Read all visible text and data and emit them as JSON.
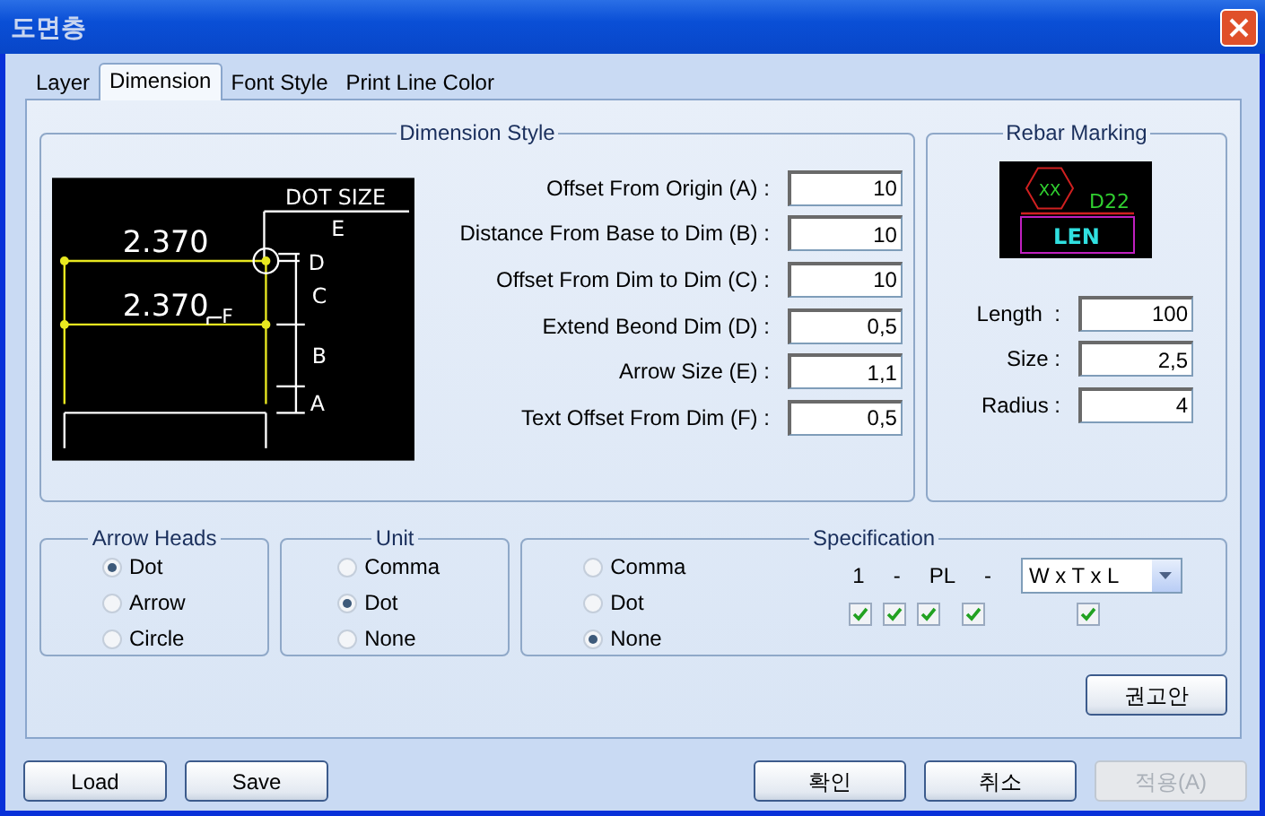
{
  "window": {
    "title": "도면층"
  },
  "tabs": [
    {
      "label": "Layer",
      "selected": false
    },
    {
      "label": "Dimension",
      "selected": true
    },
    {
      "label": "Font Style",
      "selected": false
    },
    {
      "label": "Print Line Color",
      "selected": false
    }
  ],
  "dimension_style": {
    "title": "Dimension Style",
    "diagram_labels": [
      "DOT SIZE",
      "E",
      "2.370",
      "D",
      "C",
      "2.370",
      "F",
      "B",
      "A"
    ],
    "fields": [
      {
        "label": "Offset From Origin (A) :",
        "value": "10"
      },
      {
        "label": "Distance From Base to Dim (B) :",
        "value": "10"
      },
      {
        "label": "Offset From Dim to Dim (C) :",
        "value": "10"
      },
      {
        "label": "Extend Beond Dim (D) :",
        "value": "0,5"
      },
      {
        "label": "Arrow Size (E) :",
        "value": "1,1"
      },
      {
        "label": "Text Offset From Dim (F) :",
        "value": "0,5"
      }
    ]
  },
  "rebar_marking": {
    "title": "Rebar Marking",
    "preview_labels": [
      "XX",
      "D22",
      "LEN"
    ],
    "fields": [
      {
        "label": "Length  :",
        "value": "100"
      },
      {
        "label": "Size :",
        "value": "2,5"
      },
      {
        "label": "Radius :",
        "value": "4"
      }
    ]
  },
  "arrow_heads": {
    "title": "Arrow Heads",
    "options": [
      {
        "label": "Dot",
        "selected": true
      },
      {
        "label": "Arrow",
        "selected": false
      },
      {
        "label": "Circle",
        "selected": false
      }
    ]
  },
  "unit": {
    "title": "Unit",
    "options": [
      {
        "label": "Comma",
        "selected": false
      },
      {
        "label": "Dot",
        "selected": true
      },
      {
        "label": "None",
        "selected": false
      }
    ]
  },
  "specification": {
    "title": "Specification",
    "options": [
      {
        "label": "Comma",
        "selected": false
      },
      {
        "label": "Dot",
        "selected": false
      },
      {
        "label": "None",
        "selected": true
      }
    ],
    "pattern": [
      "1",
      "-",
      "PL",
      "-"
    ],
    "format": "W x T x L",
    "checkboxes": [
      {
        "checked": true
      },
      {
        "checked": true
      },
      {
        "checked": true
      },
      {
        "checked": true
      },
      {
        "checked": true
      }
    ]
  },
  "recommend_button": {
    "label": "권고안",
    "disabled": false
  },
  "left_buttons": [
    {
      "label": "Load",
      "disabled": false
    },
    {
      "label": "Save",
      "disabled": false
    }
  ],
  "right_buttons": [
    {
      "label": "확인",
      "disabled": false
    },
    {
      "label": "취소",
      "disabled": false
    },
    {
      "label": "적용(A)",
      "disabled": true
    }
  ]
}
